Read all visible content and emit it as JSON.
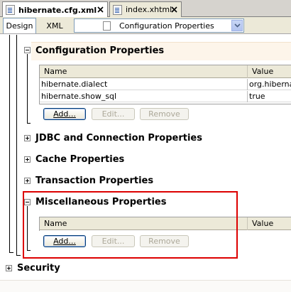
{
  "file_tabs": [
    {
      "label": "hibernate.cfg.xml",
      "active": true
    },
    {
      "label": "index.xhtml",
      "active": false
    }
  ],
  "view_tabs": [
    {
      "label": "Design",
      "active": true
    },
    {
      "label": "XML",
      "active": false
    }
  ],
  "section_select": {
    "value": "Configuration Properties"
  },
  "sections": {
    "configuration": {
      "title": "Configuration Properties",
      "expanded": true,
      "columns": [
        "Name",
        "Value"
      ],
      "rows": [
        {
          "name": "hibernate.dialect",
          "value": "org.hibernat"
        },
        {
          "name": "hibernate.show_sql",
          "value": "true"
        }
      ],
      "buttons": {
        "add": "Add...",
        "edit": "Edit...",
        "remove": "Remove"
      }
    },
    "jdbc": {
      "title": "JDBC and Connection Properties",
      "expanded": false
    },
    "cache": {
      "title": "Cache Properties",
      "expanded": false
    },
    "transaction": {
      "title": "Transaction Properties",
      "expanded": false
    },
    "misc": {
      "title": "Miscellaneous Properties",
      "expanded": true,
      "columns": [
        "Name",
        "Value"
      ],
      "rows": [],
      "buttons": {
        "add": "Add...",
        "edit": "Edit...",
        "remove": "Remove"
      }
    },
    "security": {
      "title": "Security",
      "expanded": false
    }
  },
  "colors": {
    "highlight_box": "#dd0000",
    "config_header_band": "#fdf5ea",
    "toolbar_bg": "#ece9d8"
  }
}
